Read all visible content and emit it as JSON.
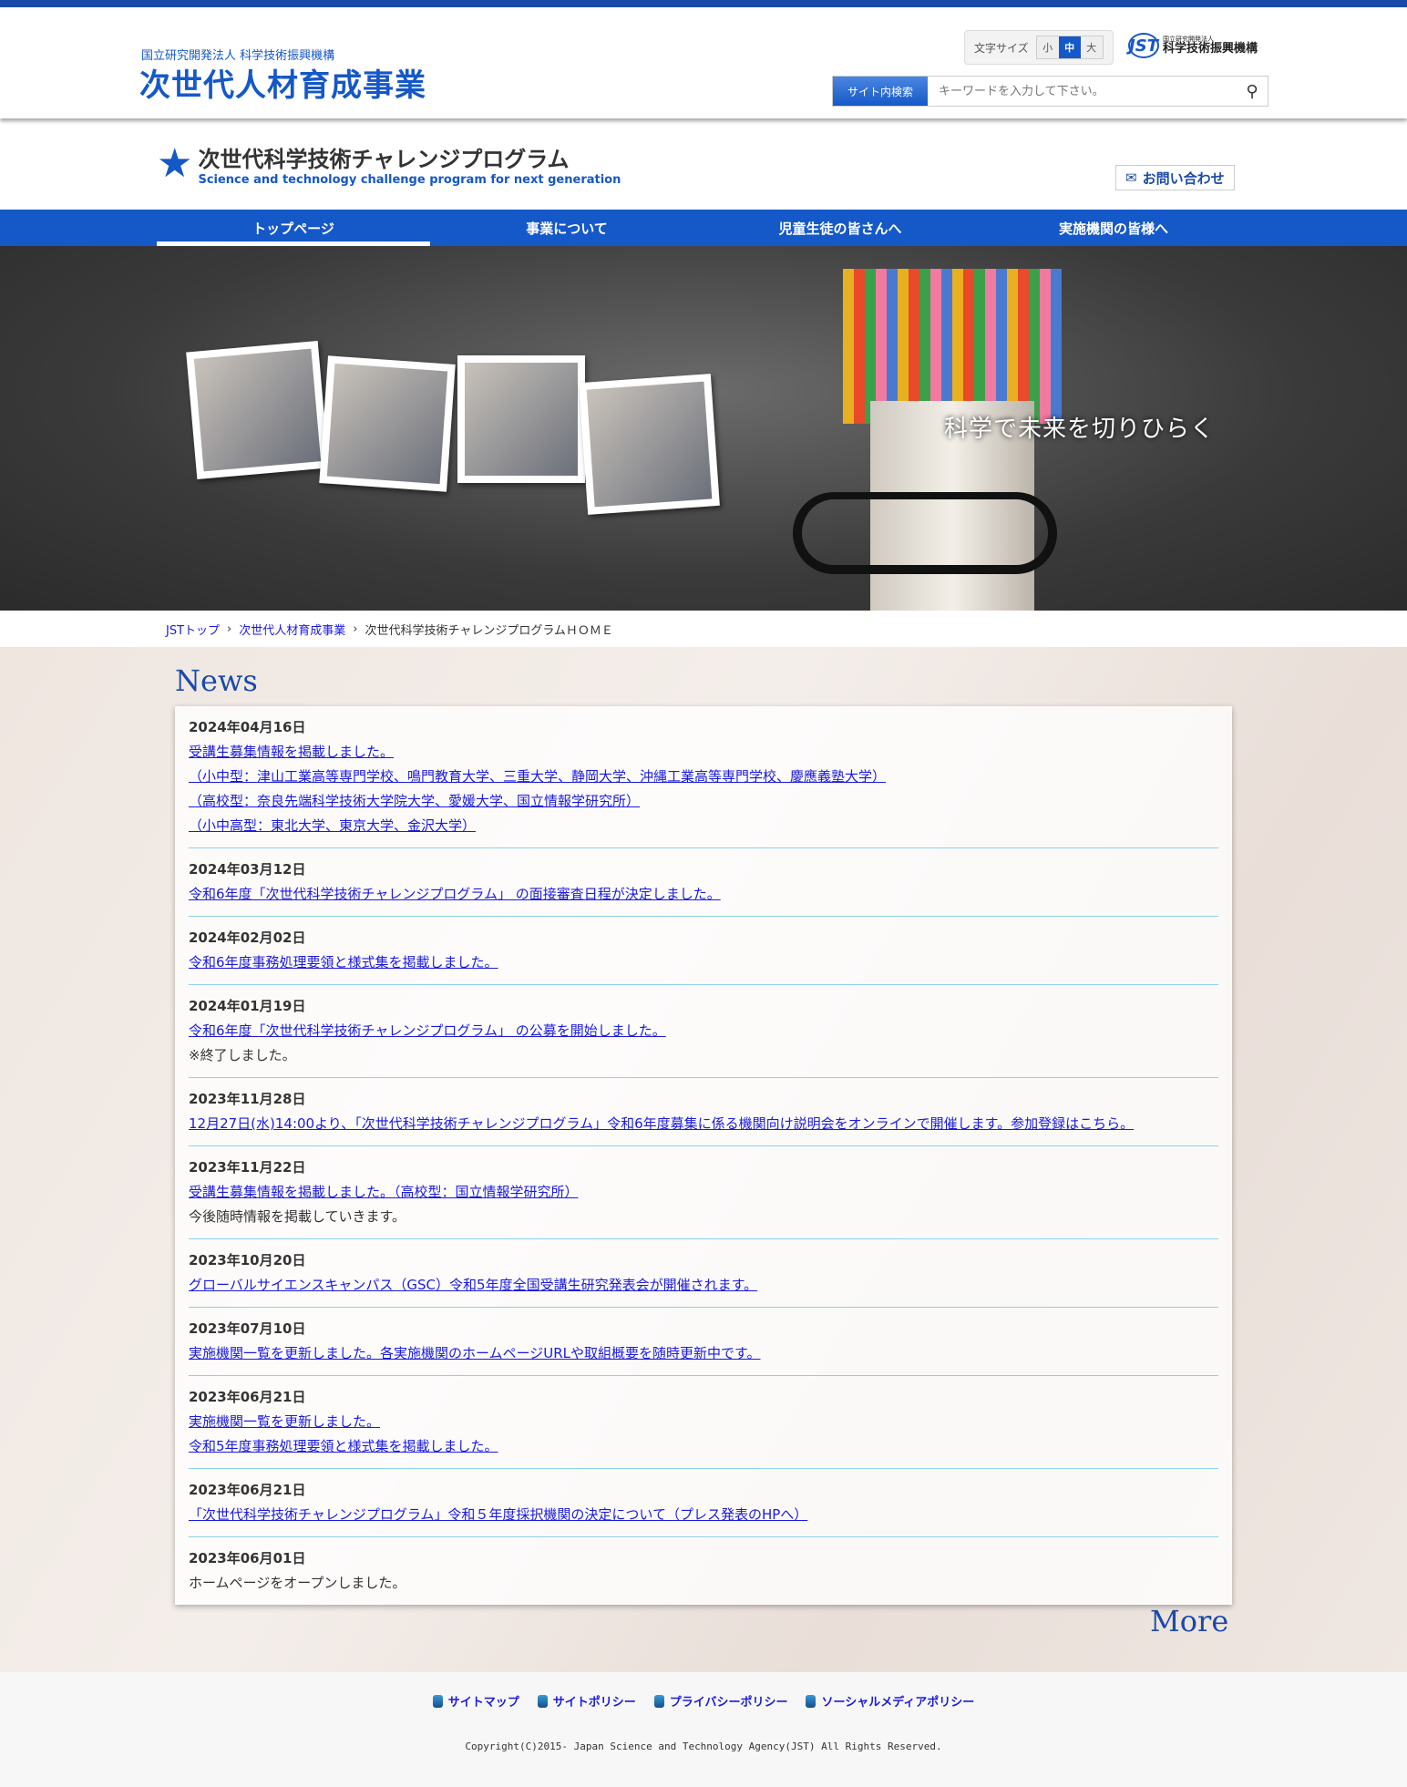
{
  "header": {
    "org": "国立研究開発法人 科学技術振興機構",
    "title": "次世代人材育成事業",
    "font_size_label": "文字サイズ",
    "font_sizes": [
      "小",
      "中",
      "大"
    ],
    "font_size_selected": "中",
    "jst_small": "国立研究開発法人",
    "jst_name": "科学技術振興機構",
    "jst_mark": "JST",
    "search_label": "サイト内検索",
    "search_placeholder": "キーワードを入力して下さい。"
  },
  "brand": {
    "title_jp": "次世代科学技術チャレンジプログラム",
    "title_en": "Science and technology challenge program for next generation",
    "contact": "お問い合わせ"
  },
  "nav": [
    "トップページ",
    "事業について",
    "児童生徒の皆さんへ",
    "実施機関の皆様へ"
  ],
  "hero": {
    "copy": "科学で未来を切りひらく"
  },
  "breadcrumb": {
    "items": [
      "JSTトップ",
      "次世代人材育成事業"
    ],
    "current": "次世代科学技術チャレンジプログラムＨＯＭＥ"
  },
  "news": {
    "heading": "News",
    "more": "More",
    "items": [
      {
        "date": "2024年04月16日",
        "links": [
          "受講生募集情報を掲載しました。",
          "（小中型：津山工業高等専門学校、鳴門教育大学、三重大学、静岡大学、沖縄工業高等専門学校、慶應義塾大学）",
          "（高校型：奈良先端科学技術大学院大学、愛媛大学、国立情報学研究所）",
          "（小中高型：東北大学、東京大学、金沢大学）"
        ],
        "text": []
      },
      {
        "date": "2024年03月12日",
        "links": [
          "令和6年度「次世代科学技術チャレンジプログラム」 の面接審査日程が決定しました。"
        ],
        "text": []
      },
      {
        "date": "2024年02月02日",
        "links": [
          "令和6年度事務処理要領と様式集を掲載しました。"
        ],
        "text": []
      },
      {
        "date": "2024年01月19日",
        "links": [
          "令和6年度「次世代科学技術チャレンジプログラム」 の公募を開始しました。"
        ],
        "text": [
          "※終了しました。"
        ]
      },
      {
        "date": "2023年11月28日",
        "links": [
          "12月27日(水)14:00より、「次世代科学技術チャレンジプログラム」令和6年度募集に係る機関向け説明会をオンラインで開催します。参加登録はこちら。"
        ],
        "text": []
      },
      {
        "date": "2023年11月22日",
        "links": [
          "受講生募集情報を掲載しました。（高校型：国立情報学研究所）"
        ],
        "text": [
          "今後随時情報を掲載していきます。"
        ]
      },
      {
        "date": "2023年10月20日",
        "links": [
          "グローバルサイエンスキャンパス（GSC）令和5年度全国受講生研究発表会が開催されます。"
        ],
        "text": []
      },
      {
        "date": "2023年07月10日",
        "links": [
          "実施機関一覧を更新しました。各実施機関のホームページURLや取組概要を随時更新中です。"
        ],
        "text": []
      },
      {
        "date": "2023年06月21日",
        "links": [
          "実施機関一覧を更新しました。",
          "令和5年度事務処理要領と様式集を掲載しました。"
        ],
        "text": []
      },
      {
        "date": "2023年06月21日",
        "links": [
          "「次世代科学技術チャレンジプログラム」令和５年度採択機関の決定について（プレス発表のHPへ）"
        ],
        "text": []
      },
      {
        "date": "2023年06月01日",
        "links": [],
        "text": [
          "ホームページをオープンしました。"
        ]
      }
    ]
  },
  "footer": {
    "links": [
      "サイトマップ",
      "サイトポリシー",
      "プライバシーポリシー",
      "ソーシャルメディアポリシー"
    ],
    "copyright": "Copyright(C)2015- Japan Science and Technology Agency(JST) All Rights Reserved."
  }
}
